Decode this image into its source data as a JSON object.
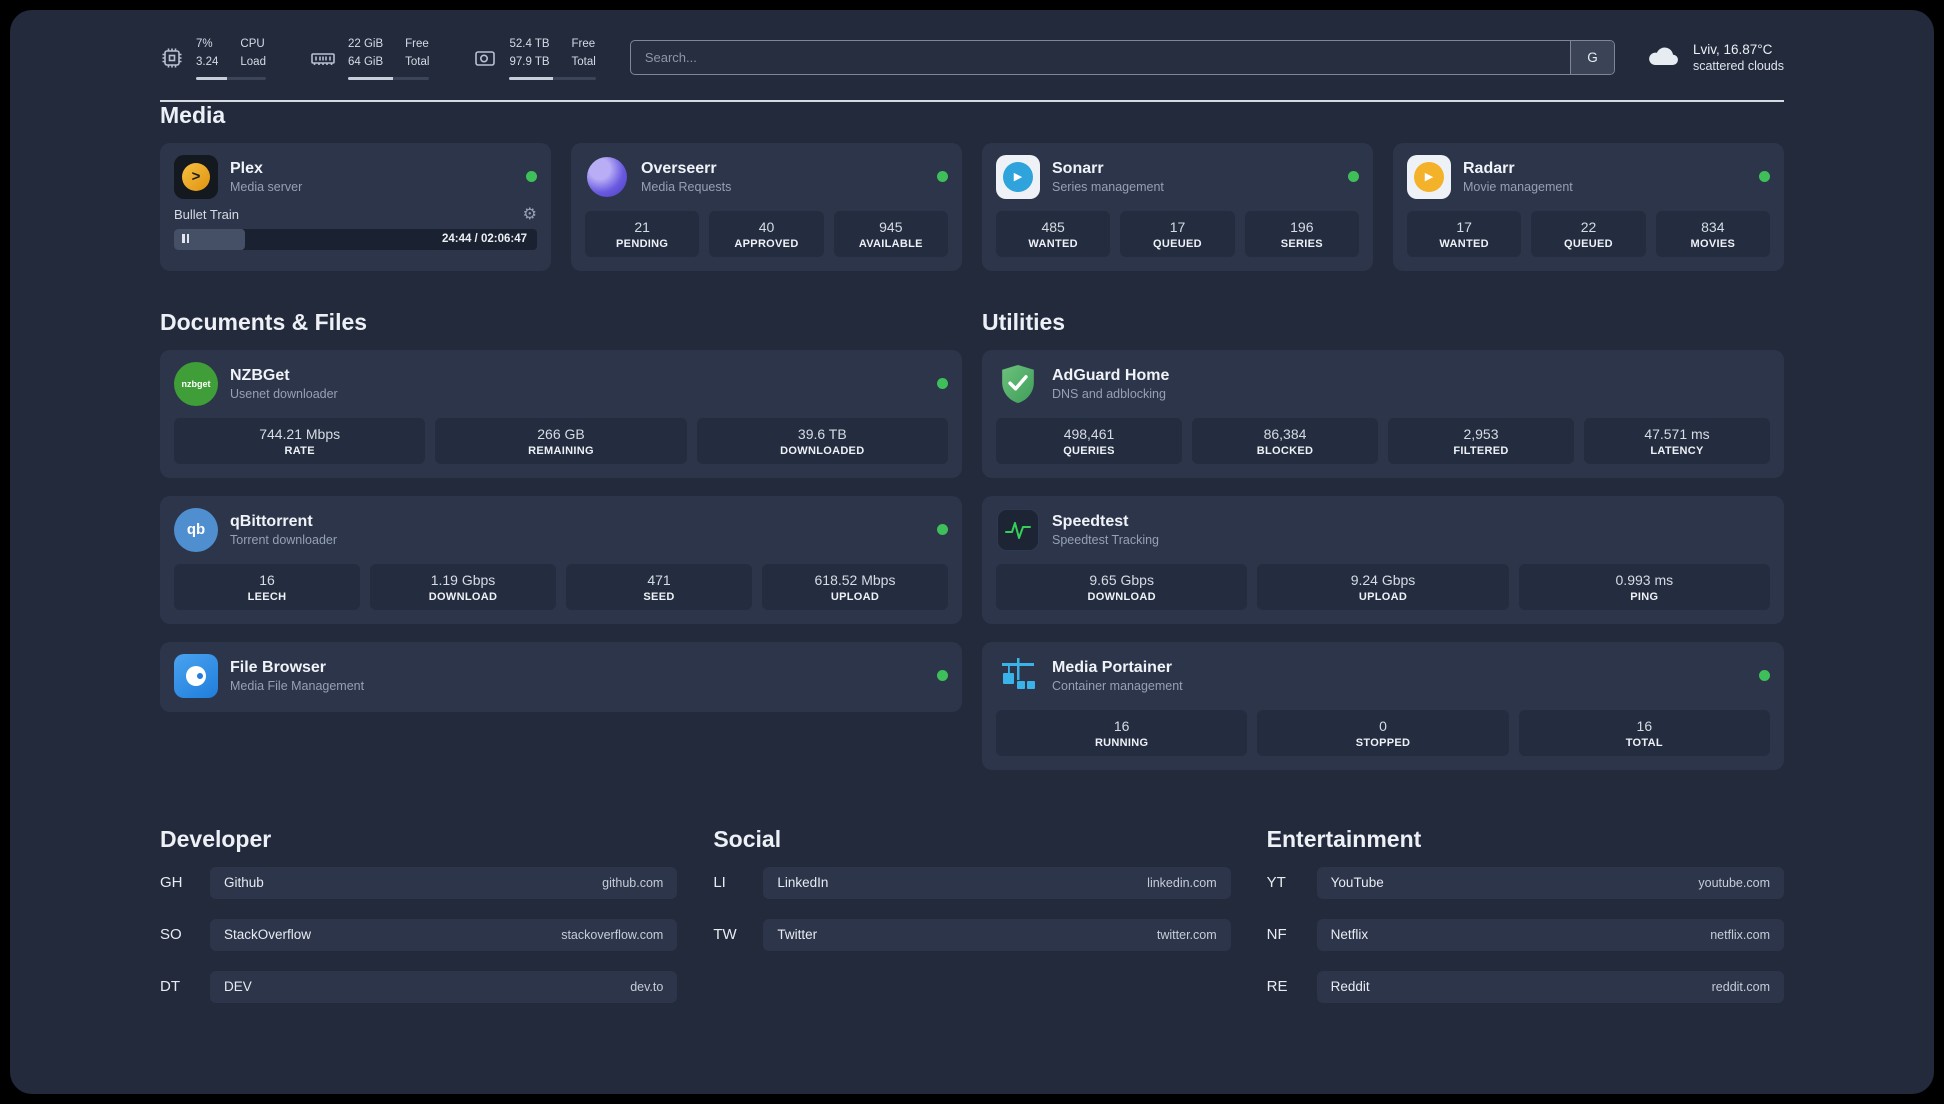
{
  "colors": {
    "background": "#222a3c",
    "card": "#2c3549",
    "tile": "#242d3f",
    "status_online": "#3fbf5a",
    "plex_brand": "#e5a00d",
    "overseerr_brand": "#6a5ae0",
    "sonarr_brand": "#2ea3dc",
    "radarr_brand": "#f3b229",
    "nzbget_brand": "#3f9e37",
    "qbittorrent_brand": "#4f8fd0",
    "filebrowser_brand": "#1f7ddb",
    "adguard_brand": "#4ca455",
    "speedtest_brand": "#34d058",
    "portainer_brand": "#3ab3e8"
  },
  "topbar": {
    "cpu": {
      "icon": "cpu-chip-icon",
      "value_top": "7%",
      "value_bottom": "3.24",
      "label_top": "CPU",
      "label_bottom": "Load",
      "bar_pct": 45
    },
    "ram": {
      "icon": "memory-icon",
      "value_top": "22 GiB",
      "value_bottom": "64 GiB",
      "label_top": "Free",
      "label_bottom": "Total",
      "bar_pct": 55
    },
    "disk": {
      "icon": "storage-drive-icon",
      "value_top": "52.4 TB",
      "value_bottom": "97.9 TB",
      "label_top": "Free",
      "label_bottom": "Total",
      "bar_pct": 50
    },
    "search": {
      "icon": "search-field",
      "placeholder": "Search...",
      "engine_label": "G"
    },
    "weather": {
      "icon": "cloud-icon",
      "location": "Lviv, 16.87°C",
      "condition": "scattered clouds"
    }
  },
  "sections": {
    "media": {
      "title": "Media",
      "cards": [
        {
          "icon": "plex-icon",
          "name": "Plex",
          "subtitle": "Media server",
          "online": true,
          "player": {
            "title": "Bullet Train",
            "time": "24:44 / 02:06:47",
            "progress_pct": 19.5
          }
        },
        {
          "icon": "overseerr-icon",
          "name": "Overseerr",
          "subtitle": "Media Requests",
          "online": true,
          "stats": [
            {
              "value": "21",
              "label": "PENDING"
            },
            {
              "value": "40",
              "label": "APPROVED"
            },
            {
              "value": "945",
              "label": "AVAILABLE"
            }
          ]
        },
        {
          "icon": "sonarr-icon",
          "name": "Sonarr",
          "subtitle": "Series management",
          "online": true,
          "stats": [
            {
              "value": "485",
              "label": "WANTED"
            },
            {
              "value": "17",
              "label": "QUEUED"
            },
            {
              "value": "196",
              "label": "SERIES"
            }
          ]
        },
        {
          "icon": "radarr-icon",
          "name": "Radarr",
          "subtitle": "Movie management",
          "online": true,
          "stats": [
            {
              "value": "17",
              "label": "WANTED"
            },
            {
              "value": "22",
              "label": "QUEUED"
            },
            {
              "value": "834",
              "label": "MOVIES"
            }
          ]
        }
      ]
    },
    "documents": {
      "title": "Documents & Files",
      "cards": [
        {
          "icon": "nzbget-icon",
          "name": "NZBGet",
          "subtitle": "Usenet downloader",
          "online": true,
          "stats": [
            {
              "value": "744.21 Mbps",
              "label": "RATE"
            },
            {
              "value": "266 GB",
              "label": "REMAINING"
            },
            {
              "value": "39.6 TB",
              "label": "DOWNLOADED"
            }
          ]
        },
        {
          "icon": "qbittorrent-icon",
          "name": "qBittorrent",
          "subtitle": "Torrent downloader",
          "online": true,
          "stats": [
            {
              "value": "16",
              "label": "LEECH"
            },
            {
              "value": "1.19 Gbps",
              "label": "DOWNLOAD"
            },
            {
              "value": "471",
              "label": "SEED"
            },
            {
              "value": "618.52 Mbps",
              "label": "UPLOAD"
            }
          ]
        },
        {
          "icon": "filebrowser-icon",
          "name": "File Browser",
          "subtitle": "Media File Management",
          "online": true
        }
      ]
    },
    "utilities": {
      "title": "Utilities",
      "cards": [
        {
          "icon": "adguard-shield-icon",
          "name": "AdGuard Home",
          "subtitle": "DNS and adblocking",
          "stats": [
            {
              "value": "498,461",
              "label": "QUERIES"
            },
            {
              "value": "86,384",
              "label": "BLOCKED"
            },
            {
              "value": "2,953",
              "label": "FILTERED"
            },
            {
              "value": "47.571 ms",
              "label": "LATENCY"
            }
          ]
        },
        {
          "icon": "speedtest-graph-icon",
          "name": "Speedtest",
          "subtitle": "Speedtest Tracking",
          "stats": [
            {
              "value": "9.65 Gbps",
              "label": "DOWNLOAD"
            },
            {
              "value": "9.24 Gbps",
              "label": "UPLOAD"
            },
            {
              "value": "0.993 ms",
              "label": "PING"
            }
          ]
        },
        {
          "icon": "portainer-crane-icon",
          "name": "Media Portainer",
          "subtitle": "Container management",
          "online": true,
          "stats": [
            {
              "value": "16",
              "label": "RUNNING"
            },
            {
              "value": "0",
              "label": "STOPPED"
            },
            {
              "value": "16",
              "label": "TOTAL"
            }
          ]
        }
      ]
    }
  },
  "bookmarks": [
    {
      "title": "Developer",
      "items": [
        {
          "abbr": "GH",
          "name": "Github",
          "url": "github.com"
        },
        {
          "abbr": "SO",
          "name": "StackOverflow",
          "url": "stackoverflow.com"
        },
        {
          "abbr": "DT",
          "name": "DEV",
          "url": "dev.to"
        }
      ]
    },
    {
      "title": "Social",
      "items": [
        {
          "abbr": "LI",
          "name": "LinkedIn",
          "url": "linkedin.com"
        },
        {
          "abbr": "TW",
          "name": "Twitter",
          "url": "twitter.com"
        }
      ]
    },
    {
      "title": "Entertainment",
      "items": [
        {
          "abbr": "YT",
          "name": "YouTube",
          "url": "youtube.com"
        },
        {
          "abbr": "NF",
          "name": "Netflix",
          "url": "netflix.com"
        },
        {
          "abbr": "RE",
          "name": "Reddit",
          "url": "reddit.com"
        }
      ]
    }
  ]
}
